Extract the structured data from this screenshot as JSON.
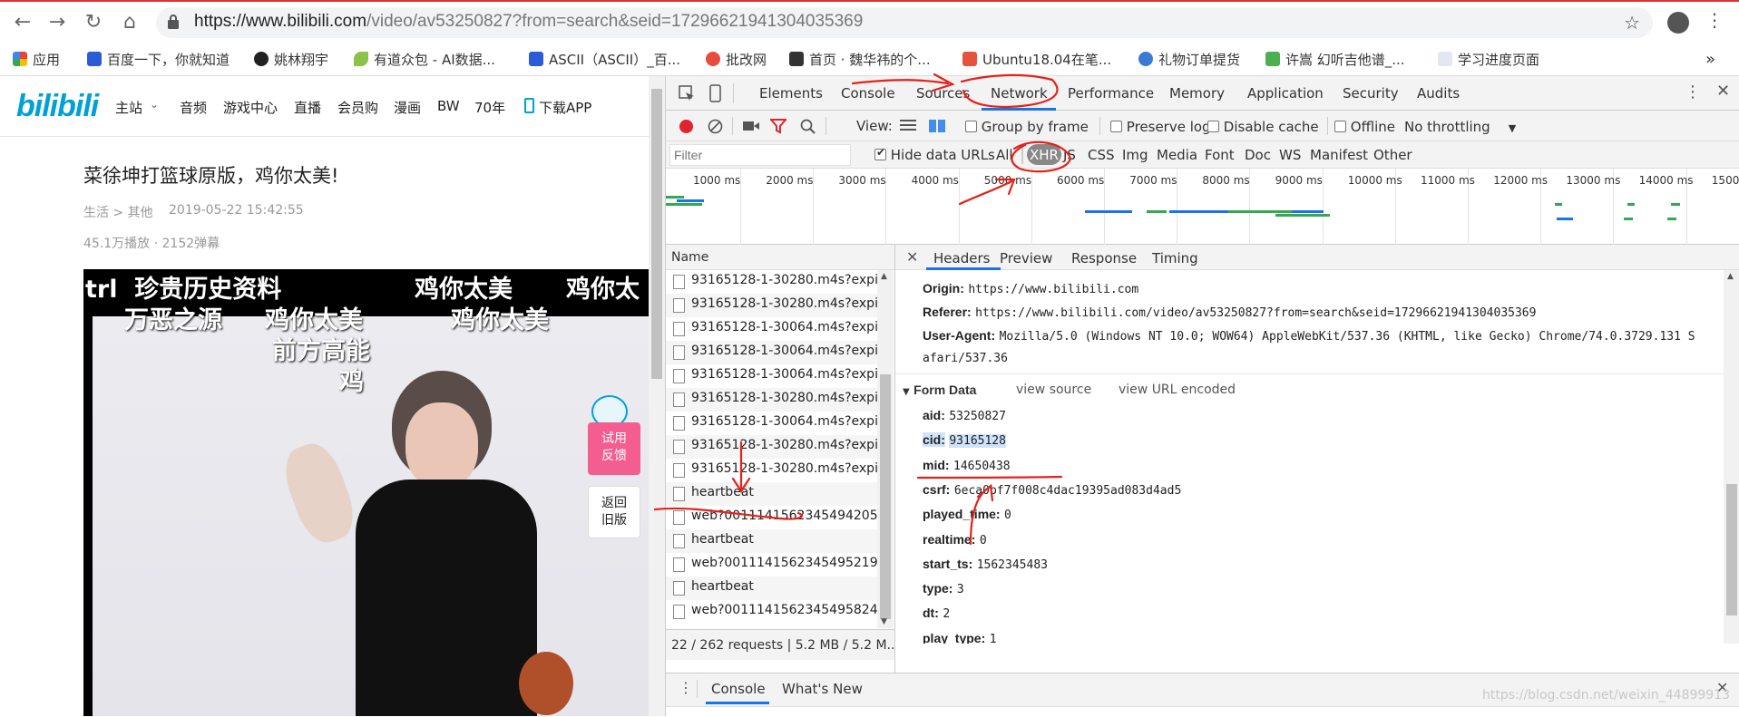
{
  "browser": {
    "url_host": "https://www.bilibili.com",
    "url_path": "/video/av53250827?from=search&seid=17296621941304035369",
    "bookmarks": [
      "应用",
      "百度一下，你就知道",
      "姚林翔宇",
      "有道众包 - AI数据...",
      "ASCII（ASCII）_百...",
      "批改网",
      "首页 · 魏华祎的个...",
      "Ubuntu18.04在笔...",
      "礼物订单提货",
      "许嵩 幻听吉他谱_...",
      "学习进度页面"
    ],
    "more": "»"
  },
  "page": {
    "logo": "bilibili",
    "nav": [
      "主站",
      "音频",
      "游戏中心",
      "直播",
      "会员购",
      "漫画",
      "BW",
      "70年",
      "下载APP"
    ],
    "title": "菜徐坤打篮球原版，鸡你太美!",
    "category": "生活 > 其他",
    "date": "2019-05-22 15:42:55",
    "stats": "45.1万播放 · 2152弹幕",
    "danmaku": [
      "trl  珍贵历史资料",
      "鸡你太美",
      "鸡你太",
      "万恶之源",
      "鸡你太美",
      "鸡你太美",
      "前方高能",
      "鸡"
    ],
    "feedback": "试用\n反馈",
    "old_version": "返回\n旧版"
  },
  "devtools": {
    "tabs": [
      "Elements",
      "Console",
      "Sources",
      "Network",
      "Performance",
      "Memory",
      "Application",
      "Security",
      "Audits"
    ],
    "active_tab": "Network",
    "toolbar": {
      "view": "View:",
      "group_by_frame": "Group by frame",
      "preserve_log": "Preserve log",
      "disable_cache": "Disable cache",
      "offline": "Offline",
      "throttling": "No throttling"
    },
    "filter": {
      "placeholder": "Filter",
      "hide_data_urls": "Hide data URLs",
      "types": [
        "All",
        "XHR",
        "JS",
        "CSS",
        "Img",
        "Media",
        "Font",
        "Doc",
        "WS",
        "Manifest",
        "Other"
      ],
      "active_type": "XHR"
    },
    "timeline_ticks": [
      "1000 ms",
      "2000 ms",
      "3000 ms",
      "4000 ms",
      "5000 ms",
      "6000 ms",
      "7000 ms",
      "8000 ms",
      "9000 ms",
      "10000 ms",
      "11000 ms",
      "12000 ms",
      "13000 ms",
      "14000 ms",
      "1500"
    ],
    "name_header": "Name",
    "requests": [
      "93165128-1-30280.m4s?expire",
      "93165128-1-30280.m4s?expire",
      "93165128-1-30064.m4s?expire",
      "93165128-1-30064.m4s?expire",
      "93165128-1-30064.m4s?expire",
      "93165128-1-30280.m4s?expire",
      "93165128-1-30064.m4s?expire",
      "93165128-1-30280.m4s?expire",
      "93165128-1-30280.m4s?expire",
      "heartbeat",
      "web?001114156234549420​51...",
      "heartbeat",
      "web?0011141562345495219​1...",
      "heartbeat",
      "web?00111415623454958241..."
    ],
    "footer": "22 / 262 requests  |  5.2 MB / 5.2 M...",
    "detail_tabs": [
      "Headers",
      "Preview",
      "Response",
      "Timing"
    ],
    "active_detail": "Headers",
    "headers": [
      {
        "k": "Origin:",
        "v": "https://www.bilibili.com"
      },
      {
        "k": "Referer:",
        "v": "https://www.bilibili.com/video/av53250827?from=search&seid=17296621941304035369"
      },
      {
        "k": "User-Agent:",
        "v": "Mozilla/5.0 (Windows NT 10.0; WOW64) AppleWebKit/537.36 (KHTML, like Gecko) Chrome/74.0.3729.131 S"
      },
      {
        "k": "",
        "v": "afari/537.36"
      }
    ],
    "form_data_title": "Form Data",
    "view_source": "view source",
    "view_url_encoded": "view URL encoded",
    "form": [
      {
        "k": "aid:",
        "v": "53250827"
      },
      {
        "k": "cid:",
        "v": "93165128"
      },
      {
        "k": "mid:",
        "v": "14650438"
      },
      {
        "k": "csrf:",
        "v": "6eca0bf7f008c4dac19395ad083d4ad5"
      },
      {
        "k": "played_time:",
        "v": "0"
      },
      {
        "k": "realtime:",
        "v": "0"
      },
      {
        "k": "start_ts:",
        "v": "1562345483"
      },
      {
        "k": "type:",
        "v": "3"
      },
      {
        "k": "dt:",
        "v": "2"
      },
      {
        "k": "play_type:",
        "v": "1"
      }
    ],
    "drawer_tabs": [
      "Console",
      "What's New"
    ],
    "watermark": "https://blog.csdn.net/weixin_44899913"
  },
  "colors": {
    "accent": "#1a73e8",
    "annotation": "#e3221b",
    "record": "#e0232e",
    "bili_blue": "#00a1d6"
  }
}
